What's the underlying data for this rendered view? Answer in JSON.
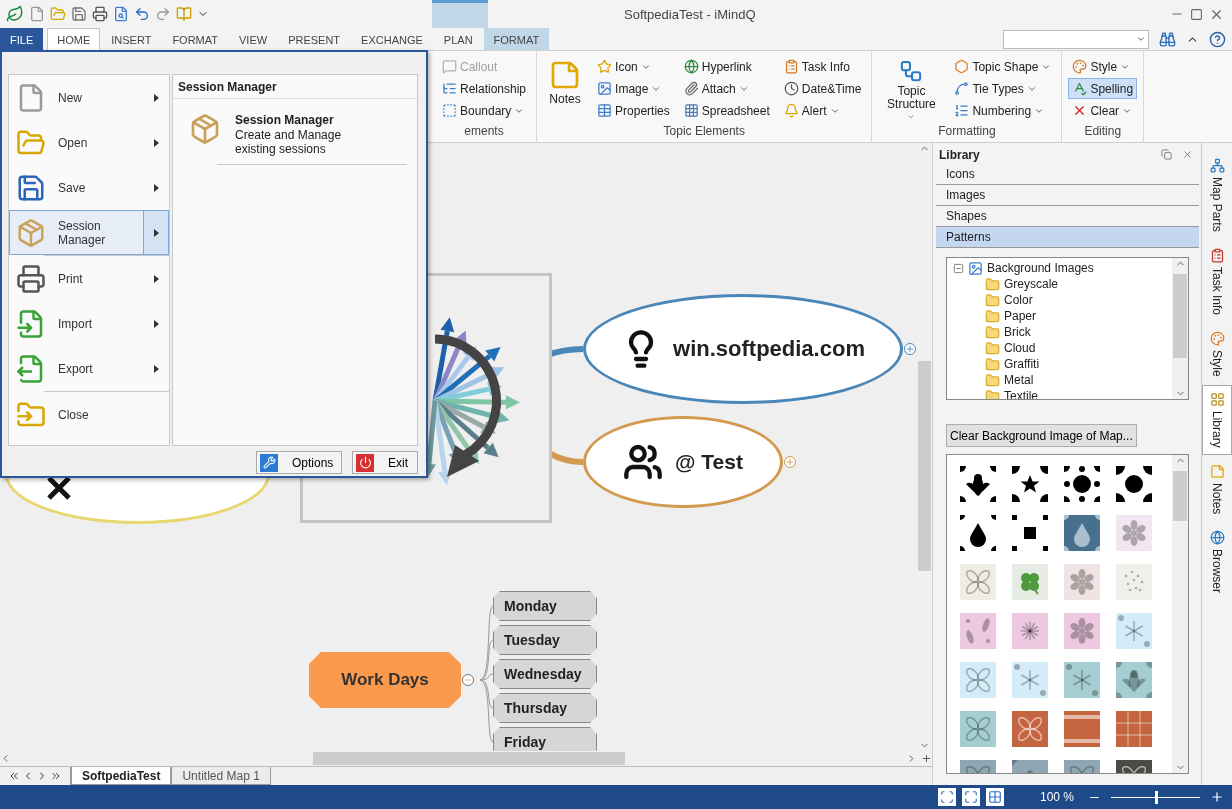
{
  "window": {
    "title": "SoftpediaTest - iMindQ"
  },
  "tabs": [
    {
      "label": "FILE",
      "kind": "file",
      "selected": false
    },
    {
      "label": "HOME",
      "kind": "normal",
      "selected": true
    },
    {
      "label": "INSERT",
      "kind": "normal",
      "selected": false
    },
    {
      "label": "FORMAT",
      "kind": "normal",
      "selected": false
    },
    {
      "label": "VIEW",
      "kind": "normal",
      "selected": false
    },
    {
      "label": "PRESENT",
      "kind": "normal",
      "selected": false
    },
    {
      "label": "EXCHANGE",
      "kind": "normal",
      "selected": false
    },
    {
      "label": "PLAN",
      "kind": "normal",
      "selected": false
    },
    {
      "label": "FORMAT",
      "kind": "contextual",
      "selected": false
    }
  ],
  "ribbon": {
    "groups": [
      {
        "label": "ements",
        "columns": [
          [
            {
              "label": "Callout",
              "dropdown": false,
              "disabled": true,
              "on": false
            },
            {
              "label": "Relationship",
              "dropdown": false,
              "disabled": false,
              "on": false
            },
            {
              "label": "Boundary",
              "dropdown": true,
              "disabled": false,
              "on": false
            }
          ]
        ]
      },
      {
        "label": "Topic Elements",
        "large": [
          {
            "label": "Notes",
            "dropdown": false
          }
        ],
        "columns": [
          [
            {
              "label": "Icon",
              "dropdown": true,
              "disabled": false,
              "on": false
            },
            {
              "label": "Image",
              "dropdown": true,
              "disabled": false,
              "on": false
            },
            {
              "label": "Properties",
              "dropdown": false,
              "disabled": false,
              "on": false
            }
          ],
          [
            {
              "label": "Hyperlink",
              "dropdown": false,
              "disabled": false,
              "on": false
            },
            {
              "label": "Attach",
              "dropdown": true,
              "disabled": false,
              "on": false
            },
            {
              "label": "Spreadsheet",
              "dropdown": false,
              "disabled": false,
              "on": false
            }
          ],
          [
            {
              "label": "Task Info",
              "dropdown": false,
              "disabled": false,
              "on": false
            },
            {
              "label": "Date&Time",
              "dropdown": false,
              "disabled": false,
              "on": false
            },
            {
              "label": "Alert",
              "dropdown": true,
              "disabled": false,
              "on": false
            }
          ]
        ]
      },
      {
        "label": "Formatting",
        "large": [
          {
            "label": "Topic Structure",
            "dropdown": true
          }
        ],
        "columns": [
          [
            {
              "label": "Topic Shape",
              "dropdown": true,
              "disabled": false,
              "on": false
            },
            {
              "label": "Tie Types",
              "dropdown": true,
              "disabled": false,
              "on": false
            },
            {
              "label": "Numbering",
              "dropdown": true,
              "disabled": false,
              "on": false
            }
          ]
        ]
      },
      {
        "label": "Editing",
        "columns": [
          [
            {
              "label": "Style",
              "dropdown": true,
              "disabled": false,
              "on": false
            },
            {
              "label": "Spelling",
              "dropdown": false,
              "disabled": false,
              "on": true
            },
            {
              "label": "Clear",
              "dropdown": true,
              "disabled": false,
              "on": false
            }
          ]
        ]
      }
    ]
  },
  "file_menu": {
    "items": [
      {
        "label": "New",
        "submenu": true,
        "selected": false,
        "separator_after": false
      },
      {
        "label": "Open",
        "submenu": true,
        "selected": false,
        "separator_after": false
      },
      {
        "label": "Save",
        "submenu": true,
        "selected": false,
        "separator_after": false
      },
      {
        "label": "Session Manager",
        "submenu": true,
        "selected": true,
        "separator_after": true
      },
      {
        "label": "Print",
        "submenu": true,
        "selected": false,
        "separator_after": false
      },
      {
        "label": "Import",
        "submenu": true,
        "selected": false,
        "separator_after": false
      },
      {
        "label": "Export",
        "submenu": true,
        "selected": false,
        "separator_after": true
      },
      {
        "label": "Close",
        "submenu": false,
        "selected": false,
        "separator_after": false
      }
    ],
    "panel": {
      "title": "Session Manager",
      "entries": [
        {
          "title": "Session Manager",
          "description": "Create and Manage existing sessions"
        }
      ]
    },
    "buttons": [
      "Options",
      "Exit"
    ]
  },
  "map": {
    "topics": [
      {
        "kind": "ellipse",
        "color": "#e8d66e"
      },
      {
        "kind": "image"
      },
      {
        "kind": "ellipse",
        "text": "win.softpedia.com",
        "color": "#4a86b8",
        "expanded": false
      },
      {
        "kind": "ellipse",
        "text": "@ Test",
        "color": "#d19a4e",
        "expanded": false
      },
      {
        "kind": "octagon",
        "text": "Work Days",
        "color": "#fb9a4c",
        "expanded": true,
        "children": [
          {
            "text": "Monday"
          },
          {
            "text": "Tuesday"
          },
          {
            "text": "Wednesday"
          },
          {
            "text": "Thursday"
          },
          {
            "text": "Friday"
          }
        ]
      }
    ]
  },
  "sheets": [
    {
      "label": "SoftpediaTest",
      "selected": true
    },
    {
      "label": "Untitled Map 1",
      "selected": false
    }
  ],
  "library": {
    "title": "Library",
    "sections": [
      {
        "label": "Icons",
        "selected": false
      },
      {
        "label": "Images",
        "selected": false
      },
      {
        "label": "Shapes",
        "selected": false
      },
      {
        "label": "Patterns",
        "selected": true
      }
    ],
    "tree": {
      "label": "Background Images",
      "expanded": true,
      "children": [
        {
          "label": "Greyscale"
        },
        {
          "label": "Color"
        },
        {
          "label": "Paper"
        },
        {
          "label": "Brick"
        },
        {
          "label": "Cloud"
        },
        {
          "label": "Graffiti"
        },
        {
          "label": "Metal"
        },
        {
          "label": "Textile"
        }
      ]
    },
    "clear_button": "Clear Background Image of Map...",
    "patterns": [
      {
        "kind": "fleur",
        "color": "#ffffff"
      },
      {
        "kind": "star",
        "color": "#ffffff"
      },
      {
        "kind": "dots",
        "color": "#ffffff"
      },
      {
        "kind": "dot",
        "color": "#ffffff"
      },
      {
        "kind": "drop",
        "color": "#ffffff"
      },
      {
        "kind": "square",
        "color": "#ffffff"
      },
      {
        "kind": "drop",
        "color": "#46708e"
      },
      {
        "kind": "flower",
        "color": "#f2e6f2"
      },
      {
        "kind": "ornament",
        "color": "#efece3"
      },
      {
        "kind": "clover",
        "color": "#e6ece4"
      },
      {
        "kind": "flower",
        "color": "#efe3e3"
      },
      {
        "kind": "speckle",
        "color": "#eef0ea"
      },
      {
        "kind": "leaf",
        "color": "#ecc9e0"
      },
      {
        "kind": "burst",
        "color": "#ecc9e0"
      },
      {
        "kind": "flower",
        "color": "#ecc9e0"
      },
      {
        "kind": "snow",
        "color": "#d3ecf8"
      },
      {
        "kind": "ornament",
        "color": "#d3ecf8"
      },
      {
        "kind": "snow",
        "color": "#d3ecf8"
      },
      {
        "kind": "snow",
        "color": "#a5ced2"
      },
      {
        "kind": "fleur",
        "color": "#a5ced2"
      },
      {
        "kind": "ornament",
        "color": "#a5ced2"
      },
      {
        "kind": "ornament",
        "color": "#c4653f"
      },
      {
        "kind": "film",
        "color": "#c4653f"
      },
      {
        "kind": "grid",
        "color": "#c4653f"
      },
      {
        "kind": "ornament",
        "color": "#8fa6b3"
      },
      {
        "kind": "diamond",
        "color": "#8fa6b3"
      },
      {
        "kind": "ornament",
        "color": "#8fa6b3"
      },
      {
        "kind": "ornament",
        "color": "#4b4a44"
      }
    ]
  },
  "side_tabs": [
    {
      "label": "Map Parts",
      "selected": false
    },
    {
      "label": "Task Info",
      "selected": false
    },
    {
      "label": "Style",
      "selected": false
    },
    {
      "label": "Library",
      "selected": true
    },
    {
      "label": "Notes",
      "selected": false
    },
    {
      "label": "Browser",
      "selected": false
    }
  ],
  "status_bar": {
    "zoom": "100 %",
    "level": 0.5
  }
}
